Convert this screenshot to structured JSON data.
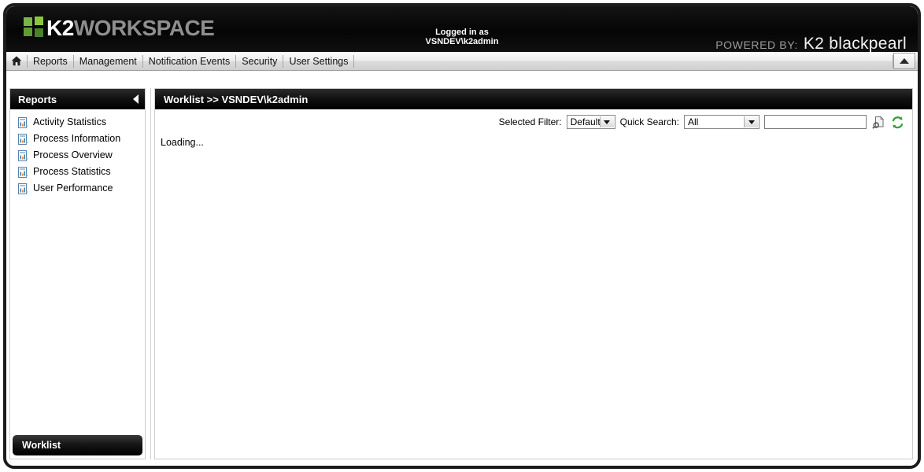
{
  "header": {
    "logo": {
      "primary": "K2",
      "secondary": "WORKSPACE",
      "icon_name": "k2-logo-squares"
    },
    "logged_in_label": "Logged in as",
    "logged_in_user": "VSNDEV\\k2admin",
    "powered_by_label": "POWERED BY:",
    "powered_by_brand": "K2 blackpearl"
  },
  "nav": {
    "home_icon": "home-icon",
    "items": [
      {
        "label": "Reports"
      },
      {
        "label": "Management"
      },
      {
        "label": "Notification Events"
      },
      {
        "label": "Security"
      },
      {
        "label": "User Settings"
      }
    ],
    "collapse_icon": "caret-up-icon"
  },
  "sidebar": {
    "title": "Reports",
    "collapse_icon": "caret-left-icon",
    "items": [
      {
        "label": "Activity Statistics",
        "icon": "report-document-icon"
      },
      {
        "label": "Process Information",
        "icon": "report-document-icon"
      },
      {
        "label": "Process Overview",
        "icon": "report-document-icon"
      },
      {
        "label": "Process Statistics",
        "icon": "report-document-icon"
      },
      {
        "label": "User Performance",
        "icon": "report-document-icon"
      }
    ],
    "footer_label": "Worklist"
  },
  "content": {
    "title": "Worklist >> VSNDEV\\k2admin",
    "toolbar": {
      "selected_filter_label": "Selected Filter:",
      "selected_filter_value": "Default",
      "quick_search_label": "Quick Search:",
      "quick_search_value": "All",
      "search_input_value": "",
      "search_input_placeholder": "",
      "search_icon": "search-page-icon",
      "refresh_icon": "refresh-icon"
    },
    "status_text": "Loading..."
  },
  "colors": {
    "accent_green": "#8cc63f",
    "header_black": "#0a0a0a",
    "refresh_green": "#3aa93a"
  }
}
